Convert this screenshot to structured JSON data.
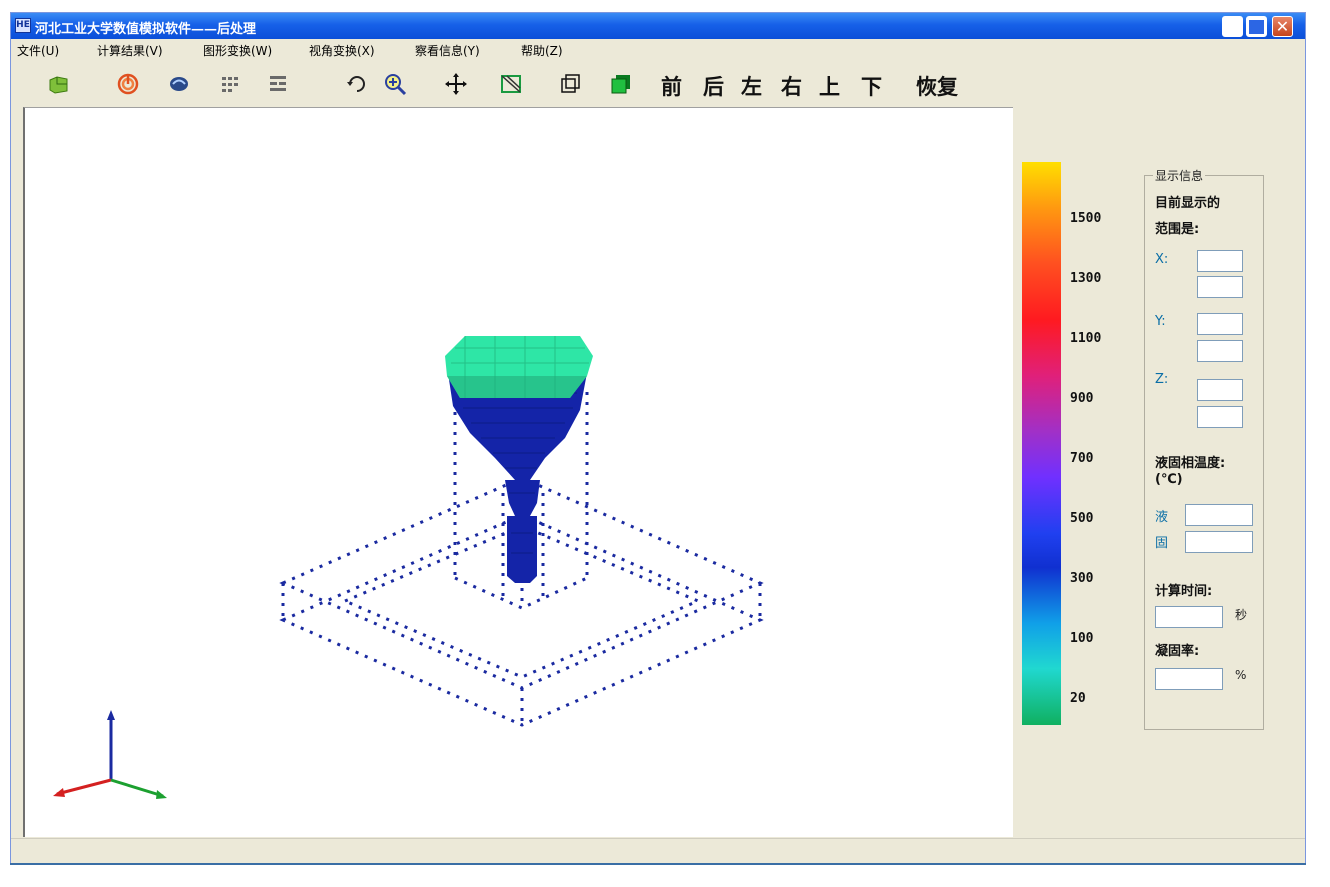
{
  "window": {
    "title": "河北工业大学数值模拟软件——后处理",
    "icon_text": "HE"
  },
  "menu": [
    {
      "label": "文件(U)"
    },
    {
      "label": "计算结果(V)"
    },
    {
      "label": "图形变换(W)"
    },
    {
      "label": "视角变换(X)"
    },
    {
      "label": "察看信息(Y)"
    },
    {
      "label": "帮助(Z)"
    }
  ],
  "toolbar": {
    "icons": [
      "open-file-icon",
      "spiral-icon",
      "swirl-icon",
      "grid-icon-1",
      "grid-icon-2",
      "rotate-icon",
      "zoom-in-icon",
      "pan-icon",
      "clip-icon",
      "wireframe-icon",
      "solid-icon"
    ],
    "view_buttons": [
      {
        "label": "前"
      },
      {
        "label": "后"
      },
      {
        "label": "左"
      },
      {
        "label": "右"
      },
      {
        "label": "上"
      },
      {
        "label": "下"
      }
    ],
    "reset_label": "恢复"
  },
  "legend": {
    "values": [
      "1500",
      "1300",
      "1100",
      "900",
      "700",
      "500",
      "300",
      "100",
      "20"
    ]
  },
  "info_panel": {
    "group_title": "显示信息",
    "range_line1": "目前显示的",
    "range_line2": "范围是:",
    "x_label": "X:",
    "y_label": "Y:",
    "z_label": "Z:",
    "phase_temp_line1": "液固相温度:",
    "phase_temp_line2": "(℃)",
    "liquid_label": "液",
    "solid_label": "固",
    "calc_time_label": "计算时间:",
    "seconds_unit": "秒",
    "solid_ratio_label": "凝固率:",
    "percent_unit": "%"
  },
  "colors": {
    "casting_top": "#2ee6a6",
    "casting_body": "#1424a8",
    "mold_dots": "#1a2aa0",
    "axis_z": "#1a2aa0",
    "axis_x": "#d42020",
    "axis_y": "#1ca030"
  }
}
